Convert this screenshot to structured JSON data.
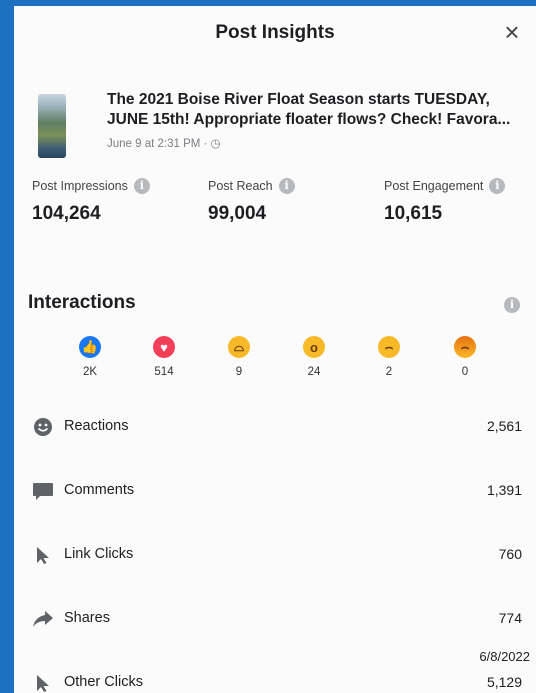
{
  "header": {
    "title": "Post Insights",
    "close_glyph": "×"
  },
  "post": {
    "thumbnail": "post-photo",
    "line1": "The 2021 Boise River Float Season starts TUESDAY,",
    "line2": "JUNE 15th! Appropriate floater flows? Check! Favora...",
    "meta": "June 9 at 2:31 PM · ◷"
  },
  "metrics": [
    {
      "label": "Post Impressions",
      "value": "104,264"
    },
    {
      "label": "Post Reach",
      "value": "99,004"
    },
    {
      "label": "Post Engagement",
      "value": "10,615"
    }
  ],
  "interactions": {
    "title": "Interactions",
    "reactions": [
      {
        "name": "like",
        "icon": "like-icon",
        "count": "2K",
        "color": "#1877f2"
      },
      {
        "name": "love",
        "icon": "love-icon",
        "count": "514",
        "color": "#f33e58"
      },
      {
        "name": "haha",
        "icon": "haha-icon",
        "count": "9",
        "color": "#f7b928"
      },
      {
        "name": "wow",
        "icon": "wow-icon",
        "count": "24",
        "color": "#f7b928"
      },
      {
        "name": "sad",
        "icon": "sad-icon",
        "count": "2",
        "color": "#f7b928"
      },
      {
        "name": "angry",
        "icon": "angry-icon",
        "count": "0",
        "color": "#e9710f"
      }
    ],
    "rows": [
      {
        "label": "Reactions",
        "icon": "smiley-icon",
        "value": "2,561"
      },
      {
        "label": "Comments",
        "icon": "comment-bubble-icon",
        "value": "1,391"
      },
      {
        "label": "Link Clicks",
        "icon": "cursor-icon",
        "value": "760"
      },
      {
        "label": "Shares",
        "icon": "share-arrow-icon",
        "value": "774"
      },
      {
        "label": "Other Clicks",
        "icon": "cursor-icon",
        "value": "5,129"
      }
    ]
  },
  "stamp": {
    "date": "6/8/2022"
  },
  "colors": {
    "background": "#1d6fbf",
    "panel": "#fbfbfb",
    "info": "#b7b9bd"
  }
}
